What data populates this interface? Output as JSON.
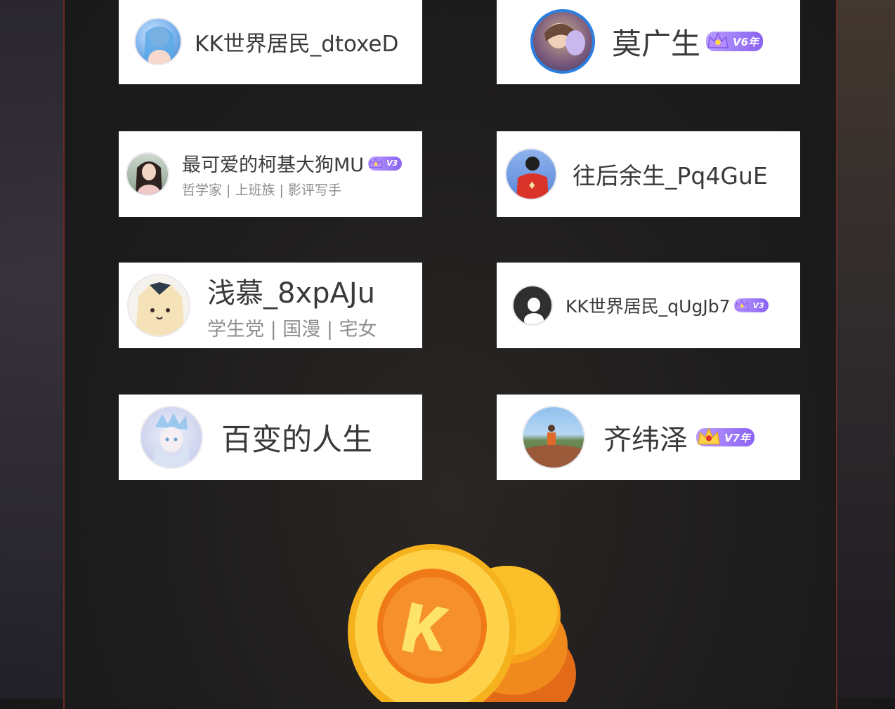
{
  "users": [
    {
      "name": "KK世界居民_dtoxeD",
      "tags": "",
      "badge": ""
    },
    {
      "name": "莫广生",
      "tags": "",
      "badge": "V6年"
    },
    {
      "name": "最可爱的柯基大狗MU",
      "tags": "哲学家 | 上班族 | 影评写手",
      "badge": "V3"
    },
    {
      "name": "往后余生_Pq4GuE",
      "tags": "",
      "badge": ""
    },
    {
      "name": "浅慕_8xpAJu",
      "tags": "学生党 | 国漫 | 宅女",
      "badge": ""
    },
    {
      "name": "KK世界居民_qUgJb7",
      "tags": "",
      "badge": "V3"
    },
    {
      "name": "百变的人生",
      "tags": "",
      "badge": ""
    },
    {
      "name": "齐纬泽",
      "tags": "",
      "badge": "V7年"
    }
  ],
  "colors": {
    "card_bg": "#ffffff",
    "panel_border": "#6b2a22",
    "vip_badge": "#8a63f2",
    "coin": "#f7a21b"
  },
  "icons": [
    "crown-icon",
    "kk-coin-icon"
  ]
}
